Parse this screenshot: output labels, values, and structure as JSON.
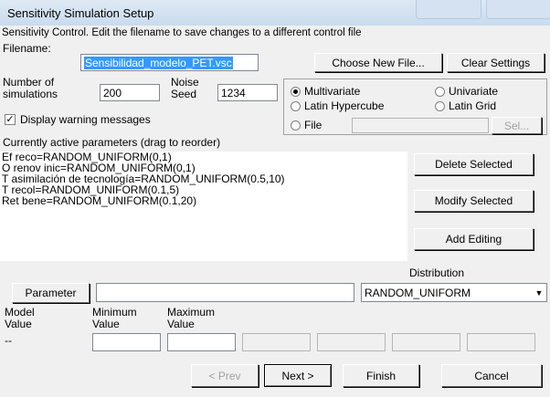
{
  "window": {
    "title": "Sensitivity Simulation Setup"
  },
  "control": {
    "description": "Sensitivity Control.  Edit the filename to save changes to a different control file",
    "filename_label": "Filename:",
    "filename_value": "Sensibilidad_modelo_PET.vsc",
    "choose_file_button": "Choose New File...",
    "clear_settings_button": "Clear Settings"
  },
  "simulation": {
    "num_label_line1": "Number of",
    "num_label_line2": "simulations",
    "num_value": "200",
    "seed_label_line1": "Noise",
    "seed_label_line2": "Seed",
    "seed_value": "1234",
    "warning_checkbox_label": "Display warning messages",
    "warning_checked": true
  },
  "methods": {
    "multivariate": "Multivariate",
    "univariate": "Univariate",
    "latin_hypercube": "Latin Hypercube",
    "latin_grid": "Latin Grid",
    "file": "File",
    "file_value": "",
    "sel_button": "Sel...",
    "selected": "multivariate"
  },
  "parameters": {
    "header": "Currently active parameters (drag to reorder)",
    "items": [
      "Ef reco=RANDOM_UNIFORM(0,1)",
      "O renov inic=RANDOM_UNIFORM(0,1)",
      "T asimilación de tecnología=RANDOM_UNIFORM(0.5,10)",
      "T recol=RANDOM_UNIFORM(0.1,5)",
      "Ret bene=RANDOM_UNIFORM(0.1,20)"
    ],
    "delete_button": "Delete Selected",
    "modify_button": "Modify Selected",
    "add_button": "Add Editing",
    "distribution_label": "Distribution"
  },
  "editor": {
    "parameter_button": "Parameter",
    "parameter_value": "",
    "distribution_value": "RANDOM_UNIFORM",
    "model_value_label_line1": "Model",
    "model_value_label_line2": "Value",
    "minimum_label_line1": "Minimum",
    "minimum_label_line2": "Value",
    "maximum_label_line1": "Maximum",
    "maximum_label_line2": "Value",
    "model_value": "--"
  },
  "footer": {
    "prev_button": "< Prev",
    "next_button": "Next >",
    "finish_button": "Finish",
    "cancel_button": "Cancel"
  }
}
